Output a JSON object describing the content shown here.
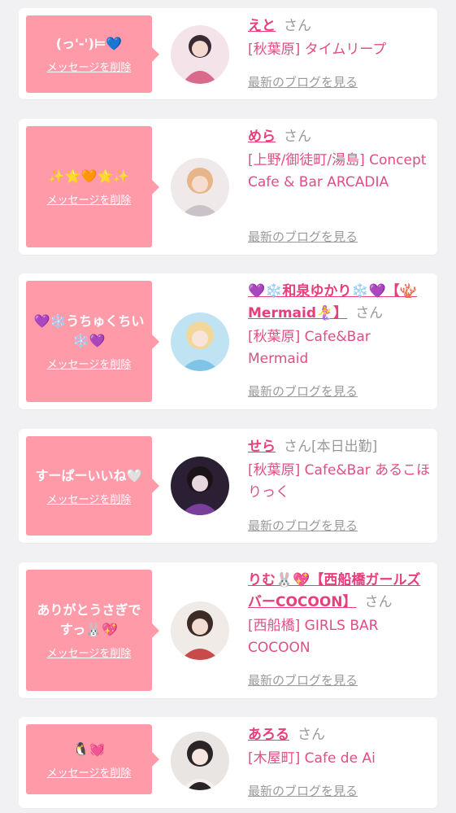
{
  "cards": [
    {
      "message": "(っ'-')⊨💙",
      "delete_label": "メッセージを削除",
      "name": "えと",
      "honorific": "さん",
      "extra": "",
      "shop": "[秋葉原] タイムリープ",
      "blog_label": "最新のブログを見る",
      "avatar_colors": [
        "#f5e3ea",
        "#d86b8c",
        "#3a2a33"
      ]
    },
    {
      "message": "✨🌟🧡🌟✨",
      "delete_label": "メッセージを削除",
      "name": "めら",
      "honorific": "さん",
      "extra": "",
      "shop": "[上野/御徒町/湯島] Concept Cafe & Bar ARCADIA",
      "blog_label": "最新のブログを見る",
      "avatar_colors": [
        "#efe9ea",
        "#e8b48a",
        "#c9c2c8"
      ]
    },
    {
      "message": "💜❄️うちゅくちい❄️💜",
      "delete_label": "メッセージを削除",
      "name": "💜❄️和泉ゆかり❄️💜【🪸Mermaid🧜‍♀️】",
      "honorific": "さん",
      "extra": "",
      "shop": "[秋葉原] Cafe&Bar Mermaid",
      "blog_label": "最新のブログを見る",
      "avatar_colors": [
        "#bfe3f3",
        "#f2d79a",
        "#7fc4e6"
      ]
    },
    {
      "message": "すーぱーいいね🤍",
      "delete_label": "メッセージを削除",
      "name": "せら",
      "honorific": "さん",
      "extra": "[本日出勤]",
      "shop": "[秋葉原] Cafe&Bar あるこほりっく",
      "blog_label": "最新のブログを見る",
      "avatar_colors": [
        "#2a1f33",
        "#7a3f9a",
        "#e8d6df"
      ]
    },
    {
      "message": "ありがとうさぎですっ🐰💖",
      "delete_label": "メッセージを削除",
      "name": "りむ🐰💖【西船橋ガールズバーCOCOON】",
      "honorific": "さん",
      "extra": "",
      "shop": "[西船橋] GIRLS BAR COCOON",
      "blog_label": "最新のブログを見る",
      "avatar_colors": [
        "#f0ebe7",
        "#3b2a25",
        "#c94a4a"
      ]
    },
    {
      "message": "🐧💓",
      "delete_label": "メッセージを削除",
      "name": "あろる",
      "honorific": "さん",
      "extra": "",
      "shop": "[木屋町] Cafe de Ai",
      "blog_label": "最新のブログを見る",
      "avatar_colors": [
        "#e9e5e3",
        "#2a2426",
        "#f3f0ee"
      ]
    }
  ]
}
